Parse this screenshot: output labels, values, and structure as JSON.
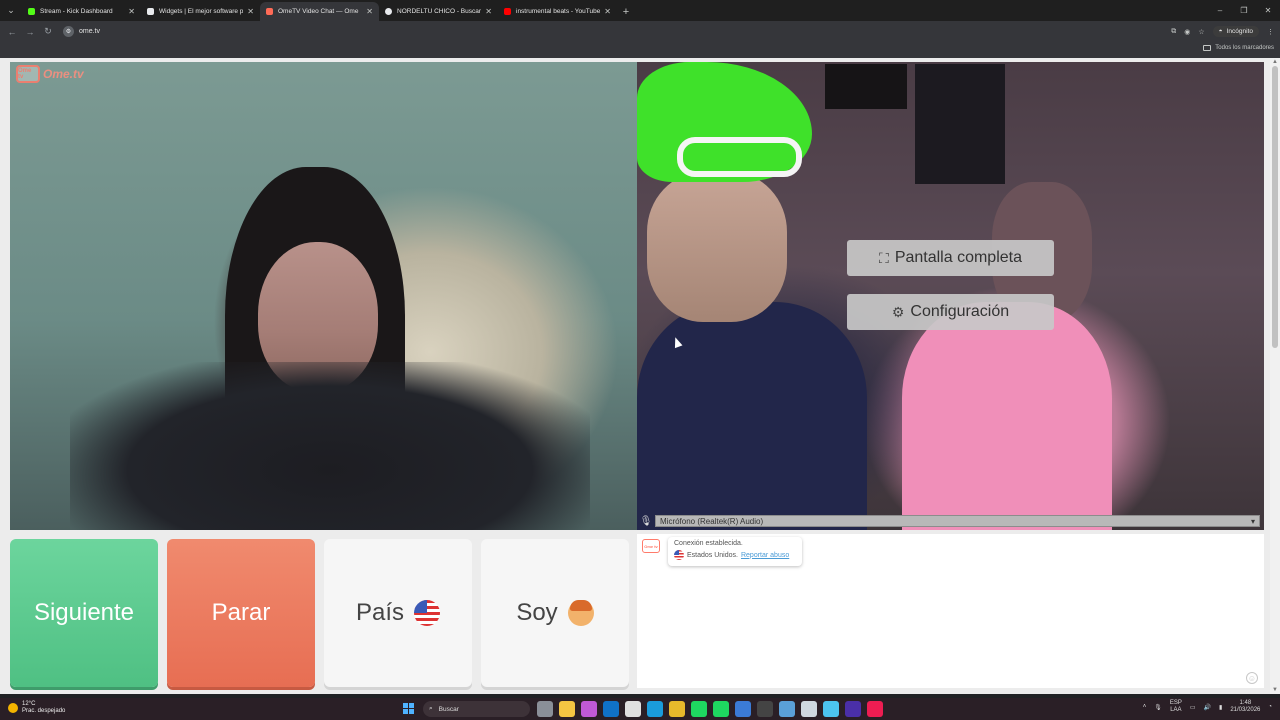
{
  "browser": {
    "tabs": [
      {
        "title": "Stream - Kick Dashboard",
        "fav_color": "#53fc18"
      },
      {
        "title": "Widgets | El mejor software pa",
        "fav_color": "#e8eaed"
      },
      {
        "title": "OmeTV Video Chat — Ome",
        "fav_color": "#ff6b57",
        "active": true
      },
      {
        "title": "NORDELTU CHICO - Buscar con",
        "fav_color": "#e8eaed"
      },
      {
        "title": "instrumental beats - YouTube",
        "fav_color": "#ff0000"
      }
    ],
    "new_tab_icon": "+",
    "url": "ome.tv",
    "incognito_label": "Incógnito",
    "bookmarks_all_label": "Todos los marcadores"
  },
  "page": {
    "logo_text": "Ome.tv",
    "logo_badge": "Ome tv",
    "overlay": {
      "fullscreen_label": "Pantalla completa",
      "settings_label": "Configuración"
    },
    "microphone_label": "Micrófono (Realtek(R) Audio)",
    "buttons": {
      "next": "Siguiente",
      "stop": "Parar",
      "country": "País",
      "me": "Soy"
    },
    "chat": {
      "status": "Conexión establecida.",
      "country": "Estados Unidos.",
      "report": "Reportar abuso"
    },
    "colors": {
      "next": "#5fcc92",
      "stop": "#ec7b60",
      "brand": "#ff7b6b"
    }
  },
  "taskbar": {
    "weather_temp": "12°C",
    "weather_desc": "Prac. despejado",
    "search_placeholder": "Buscar",
    "lang": "ESP",
    "lang2": "LAA",
    "time": "1:48",
    "date": "21/03/2026"
  }
}
